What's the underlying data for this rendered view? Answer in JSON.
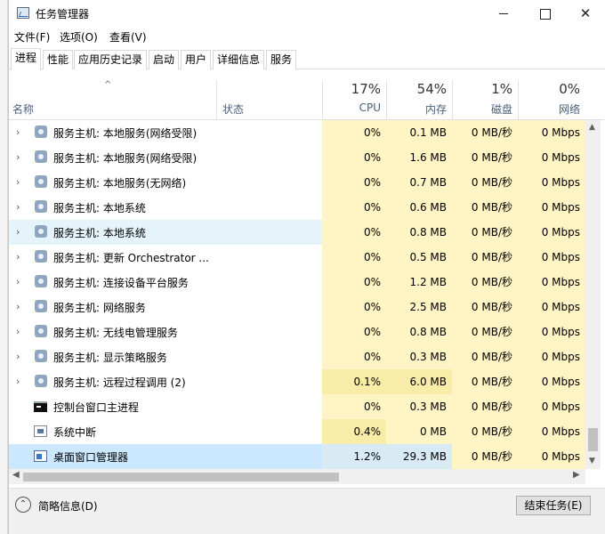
{
  "window": {
    "title": "任务管理器",
    "min_icon": "minimize-icon",
    "max_icon": "maximize-icon",
    "close_glyph": "✕"
  },
  "menu": [
    "文件(F)",
    "选项(O)",
    "查看(V)"
  ],
  "tabs": [
    "进程",
    "性能",
    "应用历史记录",
    "启动",
    "用户",
    "详细信息",
    "服务"
  ],
  "active_tab": "进程",
  "header": {
    "sort_glyph": "^",
    "name": "名称",
    "status": "状态",
    "cpu_pct": "17%",
    "cpu": "CPU",
    "mem_pct": "54%",
    "mem": "内存",
    "disk_pct": "1%",
    "disk": "磁盘",
    "net_pct": "0%",
    "net": "网络"
  },
  "rows": [
    {
      "chevron": "›",
      "icon": "gear-icon",
      "name": "服务主机: 本地服务(网络受限)",
      "cpu": "0%",
      "mem": "0.1 MB",
      "disk": "0 MB/秒",
      "net": "0 Mbps",
      "cpu_level": "l1",
      "mem_level": "l1"
    },
    {
      "chevron": "›",
      "icon": "gear-icon",
      "name": "服务主机: 本地服务(网络受限)",
      "cpu": "0%",
      "mem": "1.6 MB",
      "disk": "0 MB/秒",
      "net": "0 Mbps",
      "cpu_level": "l1",
      "mem_level": "l1"
    },
    {
      "chevron": "›",
      "icon": "gear-icon",
      "name": "服务主机: 本地服务(无网络)",
      "cpu": "0%",
      "mem": "0.7 MB",
      "disk": "0 MB/秒",
      "net": "0 Mbps",
      "cpu_level": "l1",
      "mem_level": "l1"
    },
    {
      "chevron": "›",
      "icon": "gear-icon",
      "name": "服务主机: 本地系统",
      "cpu": "0%",
      "mem": "0.6 MB",
      "disk": "0 MB/秒",
      "net": "0 Mbps",
      "cpu_level": "l1",
      "mem_level": "l1"
    },
    {
      "chevron": "›",
      "icon": "gear-icon",
      "name": "服务主机: 本地系统",
      "cpu": "0%",
      "mem": "0.8 MB",
      "disk": "0 MB/秒",
      "net": "0 Mbps",
      "cpu_level": "l1",
      "mem_level": "l1",
      "state": "hover"
    },
    {
      "chevron": "›",
      "icon": "gear-icon",
      "name": "服务主机: 更新 Orchestrator ...",
      "cpu": "0%",
      "mem": "0.5 MB",
      "disk": "0 MB/秒",
      "net": "0 Mbps",
      "cpu_level": "l1",
      "mem_level": "l1"
    },
    {
      "chevron": "›",
      "icon": "gear-icon",
      "name": "服务主机: 连接设备平台服务",
      "cpu": "0%",
      "mem": "1.2 MB",
      "disk": "0 MB/秒",
      "net": "0 Mbps",
      "cpu_level": "l1",
      "mem_level": "l1"
    },
    {
      "chevron": "›",
      "icon": "gear-icon",
      "name": "服务主机: 网络服务",
      "cpu": "0%",
      "mem": "2.5 MB",
      "disk": "0 MB/秒",
      "net": "0 Mbps",
      "cpu_level": "l1",
      "mem_level": "l1"
    },
    {
      "chevron": "›",
      "icon": "gear-icon",
      "name": "服务主机: 无线电管理服务",
      "cpu": "0%",
      "mem": "0.8 MB",
      "disk": "0 MB/秒",
      "net": "0 Mbps",
      "cpu_level": "l1",
      "mem_level": "l1"
    },
    {
      "chevron": "›",
      "icon": "gear-icon",
      "name": "服务主机: 显示策略服务",
      "cpu": "0%",
      "mem": "0.3 MB",
      "disk": "0 MB/秒",
      "net": "0 Mbps",
      "cpu_level": "l1",
      "mem_level": "l1"
    },
    {
      "chevron": "›",
      "icon": "gear-icon",
      "name": "服务主机: 远程过程调用 (2)",
      "cpu": "0.1%",
      "mem": "6.0 MB",
      "disk": "0 MB/秒",
      "net": "0 Mbps",
      "cpu_level": "l2",
      "mem_level": "l2"
    },
    {
      "chevron": "",
      "icon": "console-icon",
      "name": "控制台窗口主进程",
      "cpu": "0%",
      "mem": "0.3 MB",
      "disk": "0 MB/秒",
      "net": "0 Mbps",
      "cpu_level": "l1",
      "mem_level": "l1"
    },
    {
      "chevron": "",
      "icon": "system-icon",
      "name": "系统中断",
      "cpu": "0.4%",
      "mem": "0 MB",
      "disk": "0 MB/秒",
      "net": "0 Mbps",
      "cpu_level": "l2",
      "mem_level": "l1"
    },
    {
      "chevron": "",
      "icon": "desktop-window-icon",
      "name": "桌面窗口管理器",
      "cpu": "1.2%",
      "mem": "29.3 MB",
      "disk": "0 MB/秒",
      "net": "0 Mbps",
      "cpu_level": "sel",
      "mem_level": "sel",
      "state": "selected"
    }
  ],
  "scroll": {
    "up": "▲",
    "down": "▼",
    "left": "◀",
    "right": "▶"
  },
  "footer": {
    "less_glyph": "⌃",
    "less_label": "简略信息(D)",
    "end_task": "结束任务(E)"
  }
}
